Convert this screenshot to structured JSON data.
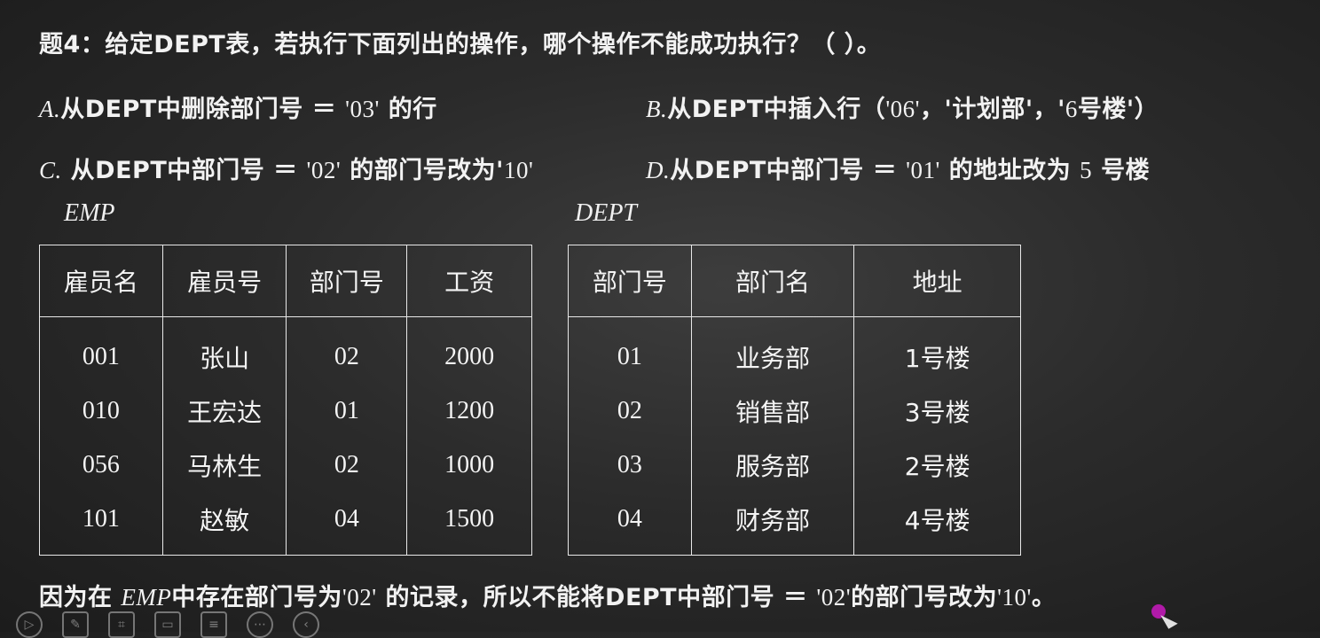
{
  "question": {
    "title": "题4：给定DEPT表，若执行下面列出的操作，哪个操作不能成功执行？（     ）。"
  },
  "options": {
    "a": {
      "letter": "A.",
      "pre": "从DEPT中删除部门号 ＝",
      "val": "'03'",
      "post": "的行"
    },
    "b": {
      "letter": "B.",
      "pre": "从DEPT中插入行（",
      "val1": "'06'",
      "sep1": "，'",
      "mid": "计划部",
      "sep2": "'，'",
      "val2": "6",
      "post": "号楼'）"
    },
    "c": {
      "letter": "C.",
      "pre": "从DEPT中部门号 ＝",
      "val": "'02'",
      "mid": "的部门号改为'",
      "val2": "10'"
    },
    "d": {
      "letter": "D.",
      "pre": "从DEPT中部门号 ＝",
      "val": "'01'",
      "mid": "的地址改为",
      "num": "5",
      "post": "号楼"
    }
  },
  "emp": {
    "label": "EMP",
    "headers": [
      "雇员名",
      "雇员号",
      "部门号",
      "工资"
    ],
    "rows": [
      [
        "001",
        "张山",
        "02",
        "2000"
      ],
      [
        "010",
        "王宏达",
        "01",
        "1200"
      ],
      [
        "056",
        "马林生",
        "02",
        "1000"
      ],
      [
        "101",
        "赵敏",
        "04",
        "1500"
      ]
    ]
  },
  "dept": {
    "label": "DEPT",
    "headers": [
      "部门号",
      "部门名",
      "地址"
    ],
    "rows": [
      [
        "01",
        "业务部",
        "1号楼"
      ],
      [
        "02",
        "销售部",
        "3号楼"
      ],
      [
        "03",
        "服务部",
        "2号楼"
      ],
      [
        "04",
        "财务部",
        "4号楼"
      ]
    ]
  },
  "answer": {
    "pre": "因为在",
    "emp": "EMP",
    "mid1": "中存在部门号为",
    "val": "'02'",
    "mid2": "的记录，所以不能将DEPT中部门号 ＝",
    "val2": "'02'",
    "mid3": "的部门号改为",
    "val3": "'10'",
    "post": "。"
  },
  "toolbar": {
    "icons": [
      "play-icon",
      "pen-icon",
      "screenshot-icon",
      "screen-icon",
      "list-icon",
      "more-icon",
      "back-icon"
    ]
  }
}
